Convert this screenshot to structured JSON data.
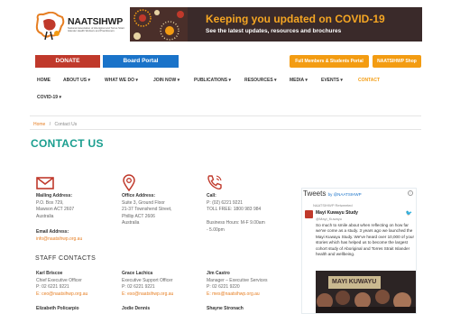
{
  "logo": {
    "name": "NAATSIHWP",
    "subtitle": "National Association of Aboriginal and Torres Strait Islander Health Workers and Practitioners"
  },
  "banner": {
    "title": "Keeping you updated on COVID-19",
    "subtitle": "See the latest updates, resources and brochures"
  },
  "buttons": {
    "donate": "DONATE",
    "board_portal": "Board Portal",
    "members_portal": "Full Members & Students Portal",
    "shop": "NAATSIHWP Shop"
  },
  "nav": {
    "items": [
      {
        "label": "HOME"
      },
      {
        "label": "ABOUT US ▾"
      },
      {
        "label": "WHAT WE DO ▾"
      },
      {
        "label": "JOIN NOW ▾"
      },
      {
        "label": "PUBLICATIONS ▾"
      },
      {
        "label": "RESOURCES ▾"
      },
      {
        "label": "MEDIA ▾"
      },
      {
        "label": "EVENTS ▾"
      },
      {
        "label": "CONTACT"
      },
      {
        "label": "COVID-19 ▾"
      }
    ]
  },
  "breadcrumb": {
    "home": "Home",
    "separator": "/",
    "current": "Contact Us"
  },
  "page_title": "CONTACT US",
  "contact": {
    "mailing": {
      "label": "Mailing Address:",
      "line1": "P.O. Box 729,",
      "line2": "Mawson ACT 2607",
      "line3": "Australia"
    },
    "email": {
      "label": "Email Address:",
      "value": "info@naatsihwp.org.au"
    },
    "office": {
      "label": "Office Address:",
      "line1": "Suite 3, Ground Floor",
      "line2": "21-37 Townshend Street,",
      "line3": "Phillip ACT 2606",
      "line4": "Australia"
    },
    "call": {
      "label": "Call:",
      "phone": "P: (02) 6221 9221",
      "tollfree": "TOLL FREE: 1800 983 984",
      "hours1": "Business Hours: M-F 9.00am",
      "hours2": "- 5.00pm"
    }
  },
  "staff_heading": "STAFF CONTACTS",
  "staff": [
    {
      "name": "Karl Briscoe",
      "role": "Chief Executive Officer",
      "phone": "P: 02 6221 9221",
      "email": "E:  ceo@naatsihwp.org.au"
    },
    {
      "name": "Grace Lachica",
      "role": "Executive Support Officer",
      "phone": "P: 02 6221 9221",
      "email": "E:  eso@naatsihwp.org.au"
    },
    {
      "name": "Jim Castro",
      "role": "Manager – Executive Services",
      "phone": "P: 02 6221 9220",
      "email": "E:  mes@naatsihwp.org.au"
    },
    {
      "name": "Elizabeth Policarpio"
    },
    {
      "name": "Jodie Dennis"
    },
    {
      "name": "Shayne Stronach"
    }
  ],
  "twitter": {
    "heading": "Tweets",
    "by": "by @NAATSIHWP",
    "retweet": "NAATSIHWP Retweeted",
    "author": "Mayi Kuwayu Study",
    "handle": "@Mayi_Kuwayu",
    "text": "So much to smile about when reflecting on how far we've come as a study. 3 years ago we launched the Mayi Kuwayu Study. We've heard over 10,000 of your stories which has helped us to become the largest cohort study of Aboriginal and Torres Strait Islander health and wellbeing.",
    "image_caption": "MAYI KUWAYU"
  },
  "colors": {
    "teal": "#1a9e8f",
    "orange": "#f39c12",
    "red": "#c0392b",
    "blue": "#1a73c9"
  }
}
